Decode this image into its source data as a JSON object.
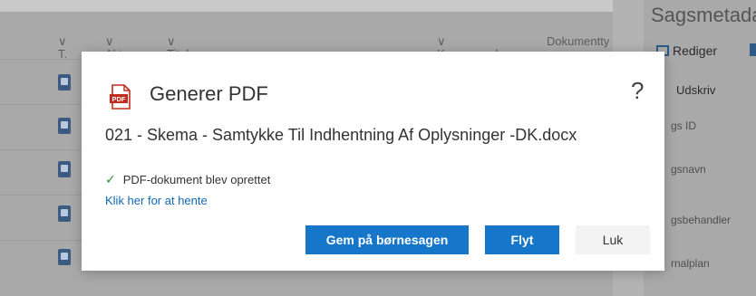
{
  "background": {
    "columns": {
      "type": "T.",
      "akt": "Akt ...",
      "titel": "Titel",
      "korrespondance": "Korresponda...",
      "dokumenttype": "Dokumentty"
    },
    "right_pane": {
      "title": "Sagsmetada",
      "edit_label": "Rediger",
      "print_label": "Udskriv",
      "fields": [
        "gs ID",
        "gsnavn",
        "gsbehandler",
        "rnalplan"
      ]
    }
  },
  "dialog": {
    "title": "Generer PDF",
    "help_symbol": "?",
    "file_name": "021 - Skema - Samtykke Til Indhentning Af Oplysninger -DK.docx",
    "status_check": "✓",
    "status_text": "PDF-dokument blev oprettet",
    "download_link": "Klik her for at hente",
    "pdf_icon_label": "PDF",
    "buttons": {
      "save": "Gem på børnesagen",
      "move": "Flyt",
      "close": "Luk"
    }
  },
  "colors": {
    "primary": "#1676c9",
    "link": "#1268b3",
    "success": "#3a8a3a",
    "pdf_red": "#c42b1c"
  }
}
